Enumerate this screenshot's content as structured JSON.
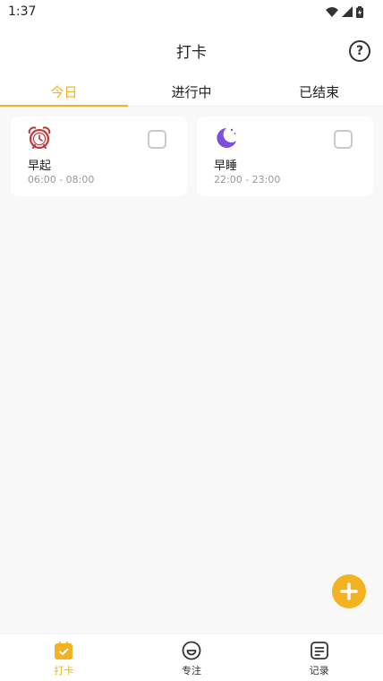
{
  "status_bar": {
    "time": "1:37"
  },
  "header": {
    "title": "打卡",
    "help_icon": "question-mark"
  },
  "tabs": [
    {
      "label": "今日",
      "active": true
    },
    {
      "label": "进行中",
      "active": false
    },
    {
      "label": "已结束",
      "active": false
    }
  ],
  "cards": [
    {
      "icon": "alarm-clock",
      "name": "早起",
      "time": "06:00 - 08:00",
      "checked": false
    },
    {
      "icon": "moon",
      "name": "早睡",
      "time": "22:00 - 23:00",
      "checked": false
    }
  ],
  "fab": {
    "icon": "plus"
  },
  "bottom_nav": [
    {
      "label": "打卡",
      "icon": "checkin",
      "active": true
    },
    {
      "label": "专注",
      "icon": "focus",
      "active": false
    },
    {
      "label": "记录",
      "icon": "record",
      "active": false
    }
  ],
  "colors": {
    "accent": "#f2b221",
    "background": "#f8f8f8",
    "text": "#222222",
    "muted": "#999999"
  }
}
